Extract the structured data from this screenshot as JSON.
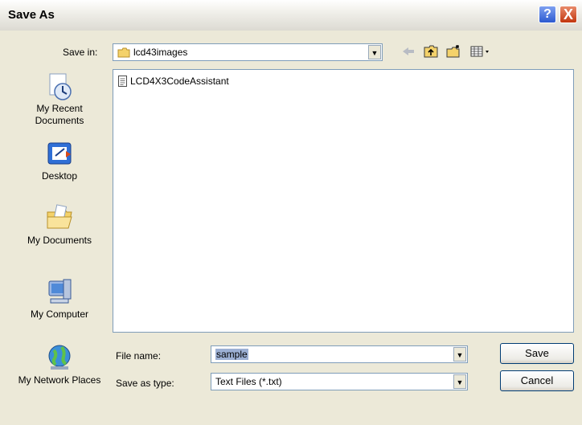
{
  "window": {
    "title": "Save As"
  },
  "titlebar": {
    "help_label": "?",
    "close_label": "X"
  },
  "save_in": {
    "label": "Save in:",
    "value": "lcd43images"
  },
  "places": [
    {
      "label": "My Recent Documents",
      "icon": "recent-documents-icon"
    },
    {
      "label": "Desktop",
      "icon": "desktop-icon"
    },
    {
      "label": "My Documents",
      "icon": "my-documents-icon"
    },
    {
      "label": "My Computer",
      "icon": "my-computer-icon"
    },
    {
      "label": "My Network Places",
      "icon": "network-places-icon"
    }
  ],
  "files": [
    {
      "name": "LCD4X3CodeAssistant",
      "icon": "text-file-icon"
    }
  ],
  "filename": {
    "label": "File name:",
    "value": "sample"
  },
  "savetype": {
    "label": "Save as type:",
    "value": "Text Files (*.txt)"
  },
  "buttons": {
    "save": "Save",
    "cancel": "Cancel"
  },
  "toolbar": [
    "back-arrow-icon",
    "up-folder-icon",
    "new-folder-icon",
    "view-menu-icon"
  ]
}
